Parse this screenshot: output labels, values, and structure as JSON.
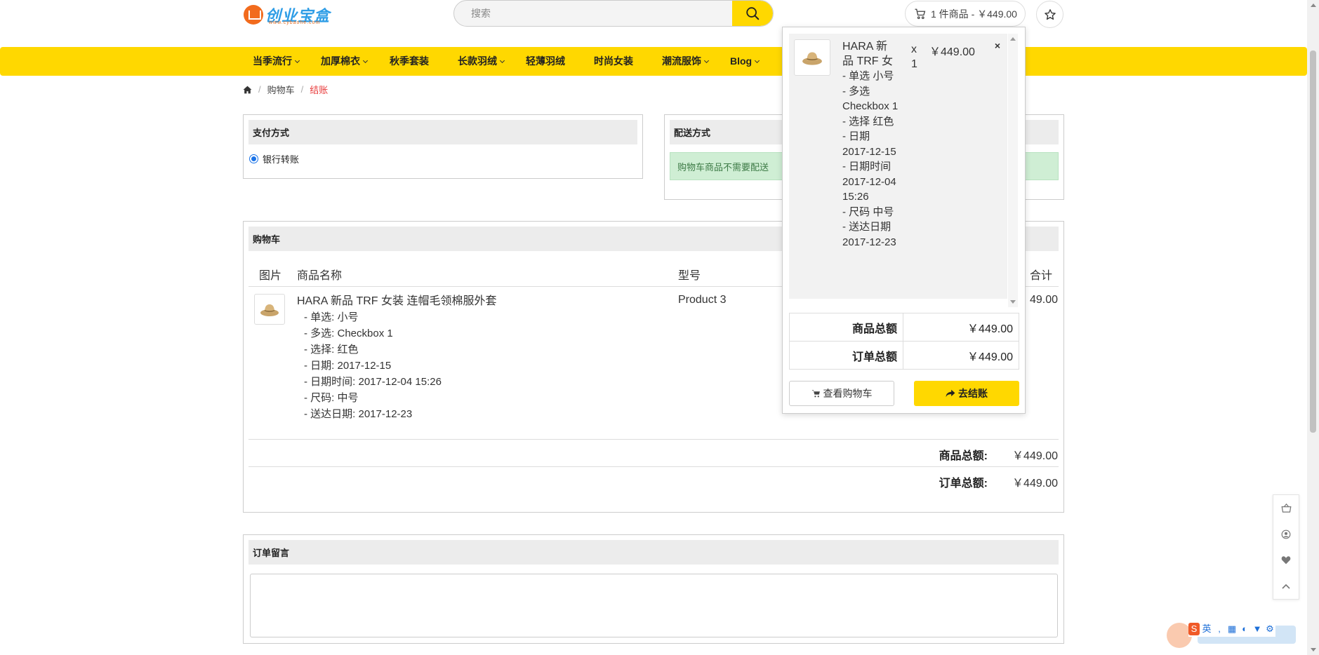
{
  "header": {
    "logo_text": "创业宝盒",
    "logo_sub": "www.cybaohe.com",
    "search_placeholder": "搜索",
    "cart_summary": "1 件商品 - ￥449.00"
  },
  "nav": {
    "items": [
      {
        "label": "当季流行",
        "dropdown": true
      },
      {
        "label": "加厚棉衣",
        "dropdown": true
      },
      {
        "label": "秋季套装",
        "dropdown": false
      },
      {
        "label": "长款羽绒",
        "dropdown": true
      },
      {
        "label": "轻薄羽绒",
        "dropdown": false
      },
      {
        "label": "时尚女装",
        "dropdown": false
      },
      {
        "label": "潮流服饰",
        "dropdown": true
      },
      {
        "label": "Blog",
        "dropdown": true
      }
    ]
  },
  "breadcrumb": {
    "home_icon": "home-icon",
    "cart": "购物车",
    "current": "结账"
  },
  "payment": {
    "title": "支付方式",
    "option": "银行转账"
  },
  "shipping": {
    "title": "配送方式",
    "notice": "购物车商品不需要配送"
  },
  "cart": {
    "title": "购物车",
    "columns": {
      "image": "图片",
      "name": "商品名称",
      "model": "型号",
      "total": "合计"
    },
    "item": {
      "name": "HARA 新品 TRF 女装 连帽毛领棉服外套",
      "options": [
        "- 单选: 小号",
        "- 多选: Checkbox 1",
        "- 选择: 红色",
        "- 日期: 2017-12-15",
        "- 日期时间: 2017-12-04 15:26",
        "- 尺码: 中号",
        "- 送达日期: 2017-12-23"
      ],
      "model": "Product 3",
      "total_partial": "49.00"
    },
    "subtotal_label": "商品总额:",
    "subtotal_value": "￥449.00",
    "total_label": "订单总额:",
    "total_value": "￥449.00"
  },
  "comment": {
    "title": "订单留言",
    "value": ""
  },
  "minicart": {
    "item_name": "HARA 新品 TRF 女",
    "item_options": [
      "- 单选 小号",
      "- 多选 Checkbox 1",
      "- 选择 红色",
      "- 日期 2017-12-15",
      "- 日期时间 2017-12-04 15:26",
      "- 尺码 中号",
      "- 送达日期 2017-12-23"
    ],
    "qty": "x 1",
    "price": "￥449.00",
    "remove": "×",
    "subtotal_label": "商品总额",
    "subtotal_value": "￥449.00",
    "total_label": "订单总额",
    "total_value": "￥449.00",
    "view_cart": "查看购物车",
    "checkout": "去结账"
  },
  "rail": [
    "basket-icon",
    "user-icon",
    "heart-icon",
    "chevron-up-icon"
  ],
  "ime": {
    "mode": "英"
  },
  "colors": {
    "accent": "#ffd800",
    "active_breadcrumb": "#e83a3a",
    "notice_bg": "#cfeed4"
  }
}
